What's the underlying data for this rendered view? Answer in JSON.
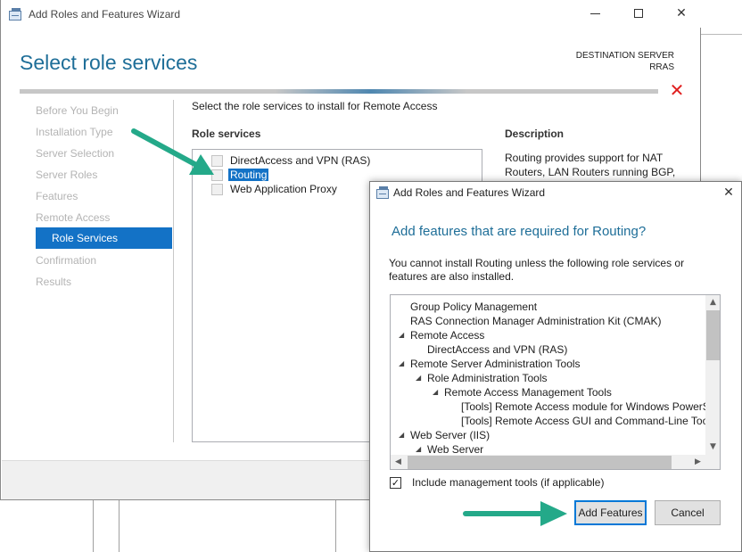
{
  "main_window": {
    "title": "Add Roles and Features Wizard",
    "page_title": "Select role services",
    "destination_label": "DESTINATION SERVER",
    "destination_server": "RRAS",
    "error_icon": "red-x-icon",
    "nav": [
      {
        "label": "Before You Begin",
        "state": "disabled"
      },
      {
        "label": "Installation Type",
        "state": "disabled"
      },
      {
        "label": "Server Selection",
        "state": "disabled"
      },
      {
        "label": "Server Roles",
        "state": "disabled"
      },
      {
        "label": "Features",
        "state": "disabled"
      },
      {
        "label": "Remote Access",
        "state": "disabled"
      },
      {
        "label": "Role Services",
        "state": "active"
      },
      {
        "label": "Confirmation",
        "state": "disabled"
      },
      {
        "label": "Results",
        "state": "disabled"
      }
    ],
    "instruction": "Select the role services to install for Remote Access",
    "role_services_header": "Role services",
    "role_services": [
      {
        "label": "DirectAccess and VPN (RAS)",
        "checked": false,
        "selected": false
      },
      {
        "label": "Routing",
        "checked": false,
        "selected": true
      },
      {
        "label": "Web Application Proxy",
        "checked": false,
        "selected": false
      }
    ],
    "description_header": "Description",
    "description_text": "Routing provides support for NAT Routers, LAN Routers running BGP,"
  },
  "dialog": {
    "title": "Add Roles and Features Wizard",
    "question": "Add features that are required for Routing?",
    "message": "You cannot install Routing unless the following role services or features are also installed.",
    "tree": [
      {
        "label": "Group Policy Management",
        "level": 0,
        "expandable": false
      },
      {
        "label": "RAS Connection Manager Administration Kit (CMAK)",
        "level": 0,
        "expandable": false
      },
      {
        "label": "Remote Access",
        "level": 0,
        "expandable": true
      },
      {
        "label": "DirectAccess and VPN (RAS)",
        "level": 1,
        "expandable": false
      },
      {
        "label": "Remote Server Administration Tools",
        "level": 0,
        "expandable": true
      },
      {
        "label": "Role Administration Tools",
        "level": 1,
        "expandable": true
      },
      {
        "label": "Remote Access Management Tools",
        "level": 2,
        "expandable": true
      },
      {
        "label": "[Tools] Remote Access module for Windows PowerShell",
        "level": 3,
        "expandable": false
      },
      {
        "label": "[Tools] Remote Access GUI and Command-Line Tools",
        "level": 3,
        "expandable": false
      },
      {
        "label": "Web Server (IIS)",
        "level": 0,
        "expandable": true
      },
      {
        "label": "Web Server",
        "level": 1,
        "expandable": true
      }
    ],
    "include_mgmt_label": "Include management tools (if applicable)",
    "include_mgmt_checked": true,
    "add_features_label": "Add Features",
    "cancel_label": "Cancel"
  },
  "colors": {
    "accent_blue": "#1e6e98",
    "selection_blue": "#1372c6",
    "arrow_green": "#24a989",
    "error_red": "#e01f1f"
  }
}
